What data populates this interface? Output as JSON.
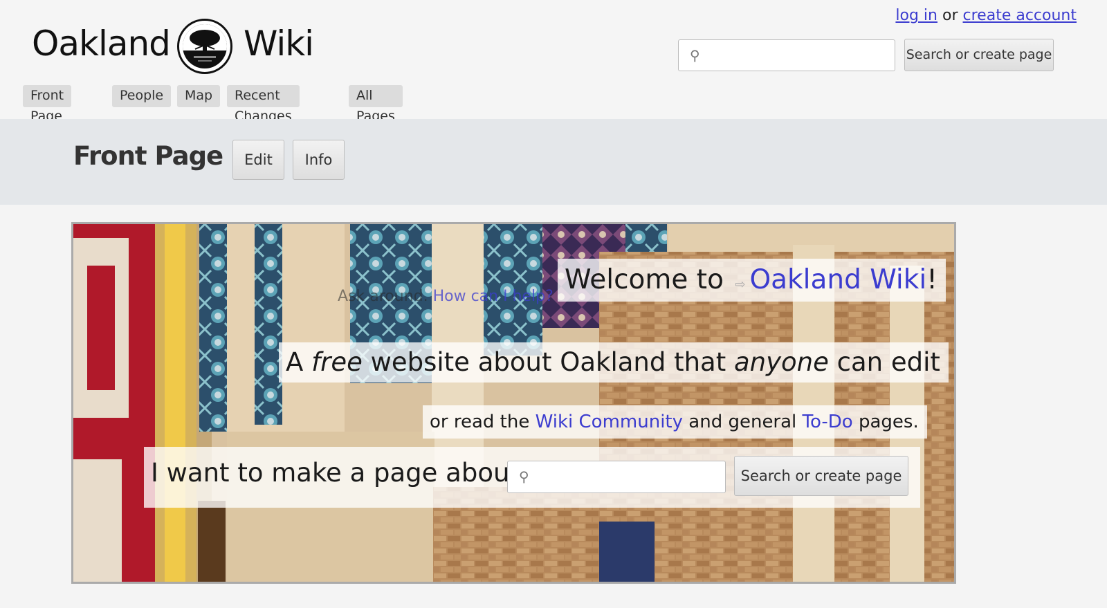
{
  "header": {
    "logo_left": "Oakland",
    "logo_right": "Wiki",
    "login_link": "log in",
    "login_or": "or",
    "create_account_link": "create account",
    "search_placeholder": "",
    "search_button": "Search or create page"
  },
  "nav": {
    "items": [
      {
        "label": "Front Page"
      },
      {
        "label": "People"
      },
      {
        "label": "Map"
      },
      {
        "label": "Recent Changes"
      },
      {
        "label": "All Pages"
      }
    ]
  },
  "titlebar": {
    "title": "Front Page",
    "edit_button": "Edit",
    "info_button": "Info"
  },
  "banner": {
    "welcome_prefix": "Welcome to ",
    "welcome_link": "Oakland Wiki",
    "welcome_suffix": "!",
    "tagline_a": "A ",
    "tagline_free": "free",
    "tagline_b": " website about Oakland that ",
    "tagline_anyone": "anyone",
    "tagline_c": " can edit",
    "read_a": "or read the ",
    "read_link1": "Wiki Community",
    "read_b": " and general ",
    "read_link2": "To-Do",
    "read_c": " pages.",
    "make_label": "I want to make a page about",
    "make_placeholder": "",
    "make_button": "Search or create page",
    "ghost_text": "Ask around. ",
    "ghost_link": "How can I help?"
  },
  "colors": {
    "link": "#3b3ccf",
    "titlebar_bg": "#e4e7ea",
    "nav_bg": "#dcdcdc"
  },
  "icons": {
    "search": "magnifier-icon",
    "link_arrow": "internal-link-arrow-icon"
  }
}
